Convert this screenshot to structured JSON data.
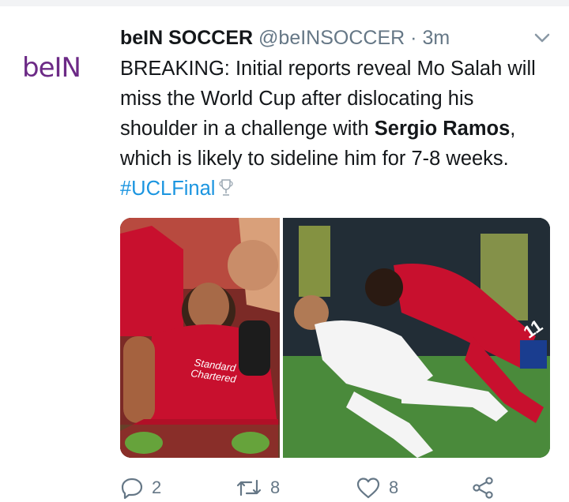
{
  "tweet": {
    "avatar_text": "beIN",
    "author_name": "beIN SOCCER",
    "handle": "@beINSOCCER",
    "separator": "·",
    "time": "3m",
    "text_part1": "BREAKING: Initial reports reveal Mo Salah will miss the World Cup after dislocating his shoulder in a challenge with ",
    "text_bold": "Sergio Ramos",
    "text_part2": ", which is likely to sideline him for 7-8 weeks. ",
    "hashtag": "#UCLFinal"
  },
  "media": {
    "left_photo_text": "Standard Chartered",
    "right_photo_number": "11"
  },
  "actions": {
    "replies": "2",
    "retweets": "8",
    "likes": "8"
  },
  "colors": {
    "brand_purple": "#6c2a86",
    "link_blue": "#1b95e0",
    "muted": "#657786",
    "liverpool_red": "#c8102e"
  },
  "icons": [
    "chevron-down-icon",
    "trophy-icon",
    "reply-icon",
    "retweet-icon",
    "like-icon",
    "share-icon"
  ]
}
